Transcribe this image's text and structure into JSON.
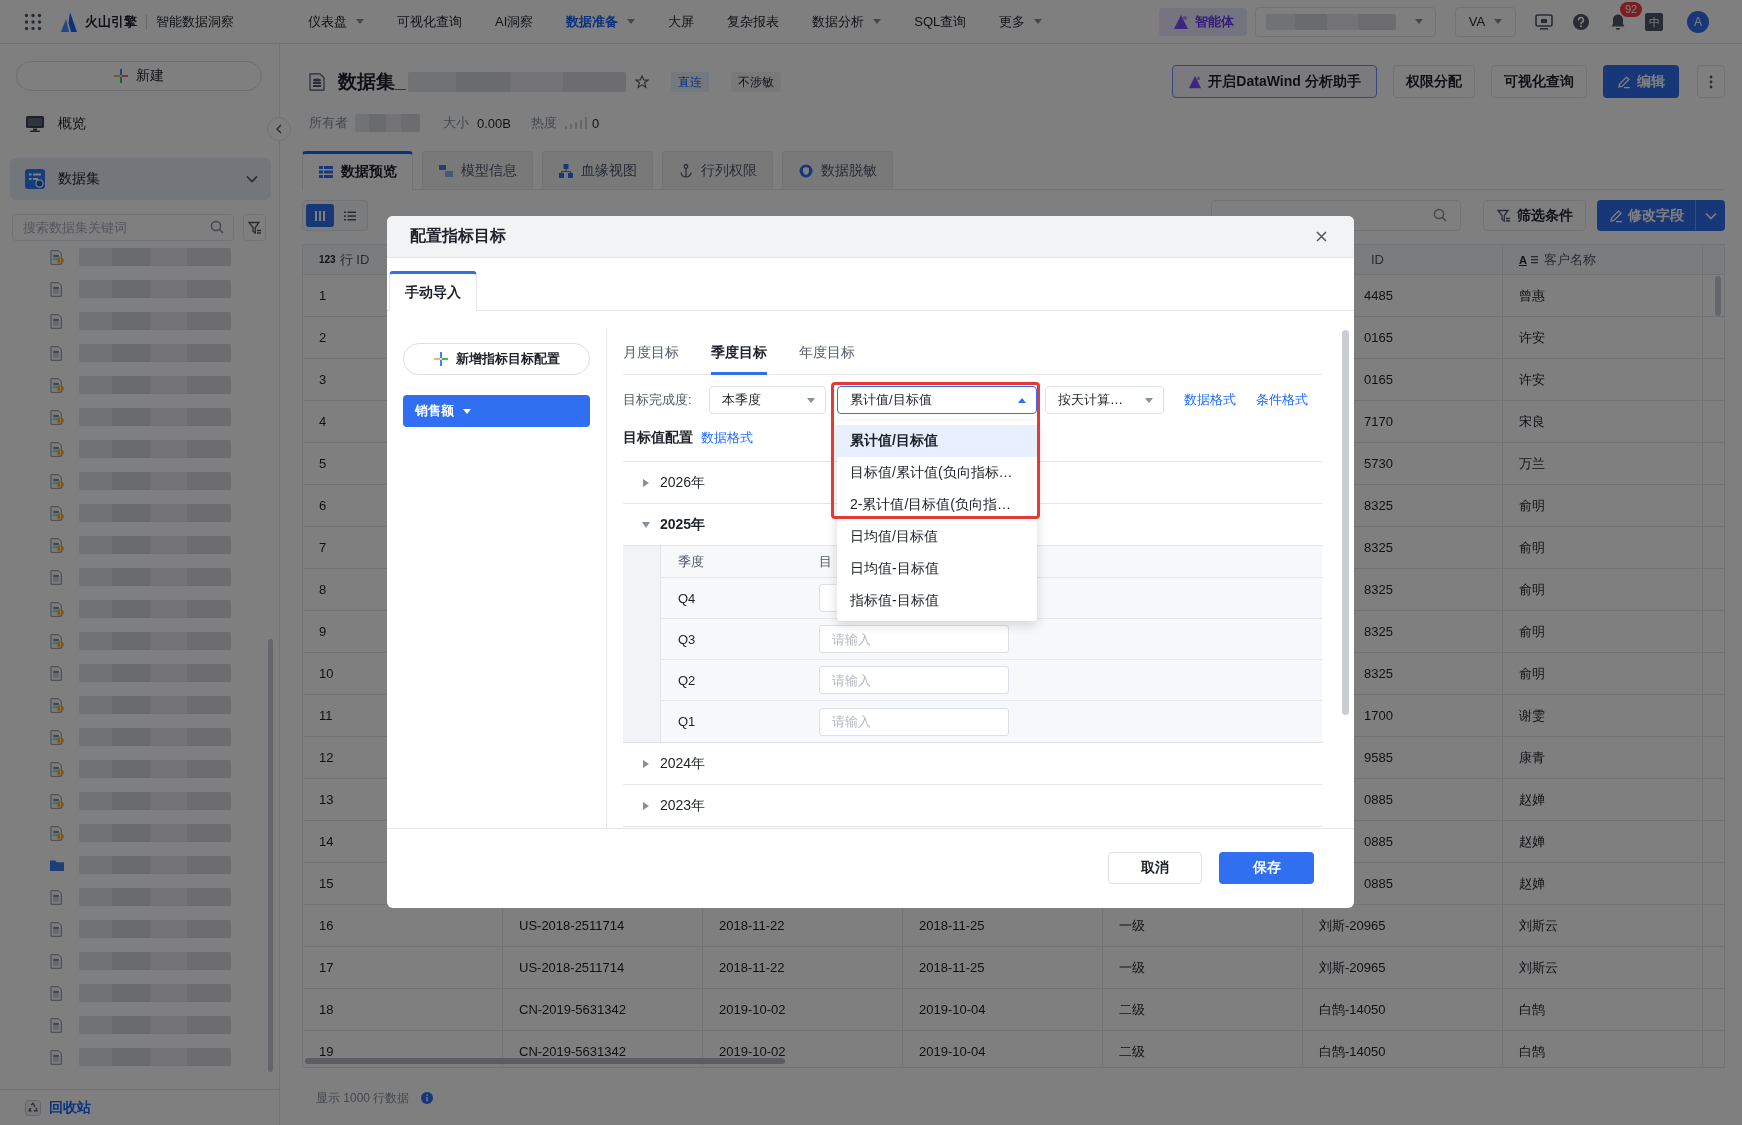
{
  "top_bar": {
    "brand": "火山引擎",
    "product": "智能数据洞察",
    "nav": [
      {
        "label": "仪表盘",
        "has_menu": true,
        "selected": false
      },
      {
        "label": "可视化查询",
        "has_menu": false,
        "selected": false
      },
      {
        "label": "AI洞察",
        "has_menu": false,
        "selected": false
      },
      {
        "label": "数据准备",
        "has_menu": true,
        "selected": true
      },
      {
        "label": "大屏",
        "has_menu": false,
        "selected": false
      },
      {
        "label": "复杂报表",
        "has_menu": false,
        "selected": false
      },
      {
        "label": "数据分析",
        "has_menu": true,
        "selected": false
      },
      {
        "label": "SQL查询",
        "has_menu": false,
        "selected": false
      },
      {
        "label": "更多",
        "has_menu": true,
        "selected": false
      }
    ],
    "agent_button": "智能体",
    "user_select": "VA",
    "notification_badge": "92",
    "language_button": "中",
    "avatar": "A"
  },
  "sidebar": {
    "new_button": "新建",
    "nav": [
      {
        "label": "概览",
        "kind": "overview",
        "selected": false
      },
      {
        "label": "数据集",
        "kind": "datasets",
        "selected": true,
        "expanded": true
      }
    ],
    "search": {
      "placeholder": "搜索数据集关键词"
    },
    "tree": [
      {
        "kind": "dataset_alert"
      },
      {
        "kind": "dataset"
      },
      {
        "kind": "dataset"
      },
      {
        "kind": "dataset"
      },
      {
        "kind": "dataset_alert"
      },
      {
        "kind": "dataset_alert"
      },
      {
        "kind": "dataset_alert"
      },
      {
        "kind": "dataset_alert"
      },
      {
        "kind": "dataset_alert"
      },
      {
        "kind": "dataset_alert"
      },
      {
        "kind": "dataset"
      },
      {
        "kind": "dataset_alert"
      },
      {
        "kind": "dataset_alert"
      },
      {
        "kind": "dataset"
      },
      {
        "kind": "dataset_alert"
      },
      {
        "kind": "dataset_alert"
      },
      {
        "kind": "dataset_alert"
      },
      {
        "kind": "dataset_alert"
      },
      {
        "kind": "dataset_alert"
      },
      {
        "kind": "folder"
      },
      {
        "kind": "dataset"
      },
      {
        "kind": "dataset"
      },
      {
        "kind": "dataset"
      },
      {
        "kind": "dataset"
      },
      {
        "kind": "dataset"
      },
      {
        "kind": "dataset"
      }
    ],
    "recycle_bin": "回收站"
  },
  "dataset": {
    "title": "数据集_",
    "tags": [
      {
        "label": "直连",
        "kind": "access"
      },
      {
        "label": "不涉敏",
        "kind": "sensitivity"
      }
    ],
    "actions": [
      {
        "label": "开启DataWind 分析助手",
        "kind": "assistant"
      },
      {
        "label": "权限分配",
        "kind": "default"
      },
      {
        "label": "可视化查询",
        "kind": "default"
      },
      {
        "label": "编辑",
        "kind": "primary"
      }
    ],
    "owner_label": "所有者",
    "size_label": "大小",
    "size": "0.00B",
    "heat_label": "热度",
    "heat": "0"
  },
  "tabs": [
    {
      "label": "数据预览",
      "selected": true
    },
    {
      "label": "模型信息",
      "selected": false
    },
    {
      "label": "血缘视图",
      "selected": false
    },
    {
      "label": "行列权限",
      "selected": false
    },
    {
      "label": "数据脱敏",
      "selected": false
    }
  ],
  "toolbar": {
    "views": [
      {
        "kind": "grid",
        "selected": true
      },
      {
        "kind": "list",
        "selected": false
      }
    ],
    "filter_button": "筛选条件",
    "edit_fields_button": "修改字段"
  },
  "table": {
    "header": {
      "row_id": {
        "kind": "number",
        "type_label": "123",
        "label": "行 ID"
      },
      "column_6": {
        "kind": "partly_covered",
        "label": "ID"
      },
      "customer_name": {
        "kind": "text",
        "type_label": "A",
        "label": "客户名称"
      }
    },
    "rows": [
      {
        "kind": "partly_covered",
        "row_id": "1",
        "column_6": "4485",
        "customer_name": "曾惠"
      },
      {
        "kind": "partly_covered",
        "row_id": "2",
        "column_6": "0165",
        "customer_name": "许安"
      },
      {
        "kind": "partly_covered",
        "row_id": "3",
        "column_6": "0165",
        "customer_name": "许安"
      },
      {
        "kind": "partly_covered",
        "row_id": "4",
        "column_6": "7170",
        "customer_name": "宋良"
      },
      {
        "kind": "partly_covered",
        "row_id": "5",
        "column_6": "5730",
        "customer_name": "万兰"
      },
      {
        "kind": "partly_covered",
        "row_id": "6",
        "column_6": "8325",
        "customer_name": "俞明"
      },
      {
        "kind": "partly_covered",
        "row_id": "7",
        "column_6": "8325",
        "customer_name": "俞明"
      },
      {
        "kind": "partly_covered",
        "row_id": "8",
        "column_6": "8325",
        "customer_name": "俞明"
      },
      {
        "kind": "partly_covered",
        "row_id": "9",
        "column_6": "8325",
        "customer_name": "俞明"
      },
      {
        "kind": "partly_covered",
        "row_id": "10",
        "column_6": "8325",
        "customer_name": "俞明"
      },
      {
        "kind": "partly_covered",
        "row_id": "11",
        "column_6": "1700",
        "customer_name": "谢雯"
      },
      {
        "kind": "partly_covered",
        "row_id": "12",
        "column_6": "9585",
        "customer_name": "康青"
      },
      {
        "kind": "partly_covered",
        "row_id": "13",
        "column_6": "0885",
        "customer_name": "赵婵"
      },
      {
        "kind": "partly_covered",
        "row_id": "14",
        "column_6": "0885",
        "customer_name": "赵婵"
      },
      {
        "kind": "partly_covered",
        "row_id": "15",
        "column_6": "0885",
        "customer_name": "赵婵"
      },
      {
        "kind": "full",
        "row_id": "16",
        "column_2": "US-2018-2511714",
        "column_3": "2018-11-22",
        "column_4": "2018-11-25",
        "column_5": "一级",
        "column_6": "刘斯-20965",
        "customer_name": "刘斯云"
      },
      {
        "kind": "full",
        "row_id": "17",
        "column_2": "US-2018-2511714",
        "column_3": "2018-11-22",
        "column_4": "2018-11-25",
        "column_5": "一级",
        "column_6": "刘斯-20965",
        "customer_name": "刘斯云"
      },
      {
        "kind": "full",
        "row_id": "18",
        "column_2": "CN-2019-5631342",
        "column_3": "2019-10-02",
        "column_4": "2019-10-04",
        "column_5": "二级",
        "column_6": "白鹄-14050",
        "customer_name": "白鹄"
      },
      {
        "kind": "full",
        "row_id": "19",
        "column_2": "CN-2019-5631342",
        "column_3": "2019-10-02",
        "column_4": "2019-10-04",
        "column_5": "二级",
        "column_6": "白鹄-14050",
        "customer_name": "白鹄"
      }
    ]
  },
  "footer": {
    "row_count": "显示 1000 行数据"
  },
  "dialog": {
    "title": "配置指标目标",
    "tabs": [
      {
        "label": "手动导入",
        "selected": true
      }
    ],
    "add_button": "新增指标目标配置",
    "metrics": [
      {
        "label": "销售额",
        "selected": true
      }
    ],
    "period_tabs": [
      {
        "label": "月度目标",
        "selected": false
      },
      {
        "label": "季度目标",
        "selected": true
      },
      {
        "label": "年度目标",
        "selected": false
      }
    ],
    "completion": {
      "label": "目标完成度:",
      "period_select": "本季度",
      "formula_select": {
        "value": "累计值/目标值",
        "expanded": true
      },
      "method_select": "按天计算…",
      "links": [
        "数据格式",
        "条件格式"
      ]
    },
    "formula_options": [
      {
        "label": "累计值/目标值",
        "selected": true
      },
      {
        "label": "目标值/累计值(负向指标…",
        "selected": false
      },
      {
        "label": "2-累计值/目标值(负向指…",
        "selected": false
      },
      {
        "label": "日均值/目标值",
        "selected": false
      },
      {
        "label": "日均值-目标值",
        "selected": false
      },
      {
        "label": "指标值-目标值",
        "selected": false
      }
    ],
    "target_config": {
      "title": "目标值配置",
      "link": "数据格式"
    },
    "years": [
      {
        "label": "2026年",
        "expanded": false
      },
      {
        "label": "2025年",
        "expanded": true,
        "columns": [
          "季度",
          "目"
        ],
        "quarters": [
          {
            "label": "Q4"
          },
          {
            "label": "Q3",
            "placeholder": "请输入"
          },
          {
            "label": "Q2",
            "placeholder": "请输入"
          },
          {
            "label": "Q1",
            "placeholder": "请输入"
          }
        ]
      },
      {
        "label": "2024年",
        "expanded": false
      },
      {
        "label": "2023年",
        "expanded": false
      }
    ],
    "buttons": [
      {
        "label": "取消",
        "kind": "default"
      },
      {
        "label": "保存",
        "kind": "primary"
      }
    ]
  }
}
